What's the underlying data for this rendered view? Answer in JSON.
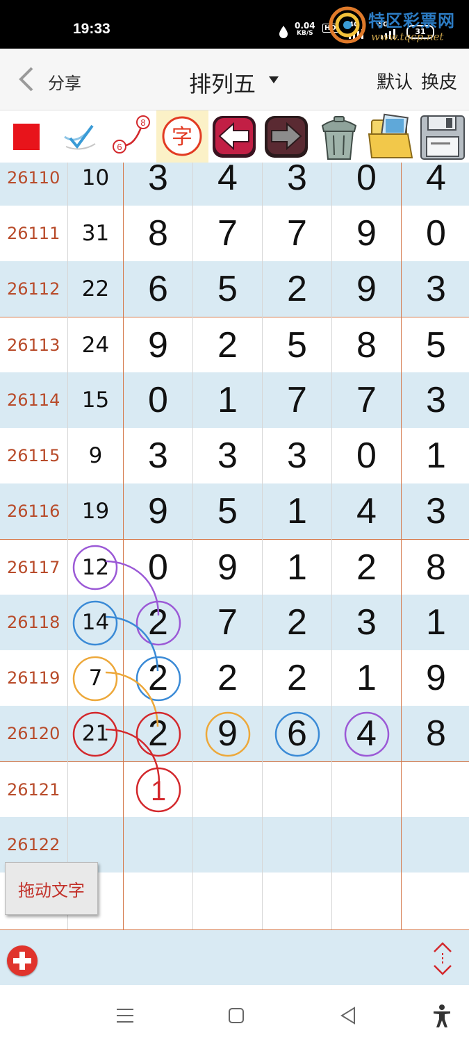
{
  "status_bar": {
    "time": "19:33",
    "net_speed": "0.04",
    "net_unit": "KB/S",
    "tag_hd": "HD",
    "tag_4g": "4G",
    "tag_5g": "5G",
    "battery": "31"
  },
  "watermark": {
    "name": "特区彩票网",
    "url": "www.tqcp.net"
  },
  "header": {
    "share_label": "分享",
    "title": "排列五",
    "default_label": "默认",
    "skin_label": "换皮"
  },
  "toolbar": {
    "items": [
      {
        "name": "red-square-icon",
        "color": "#e8141b"
      },
      {
        "name": "check-pen-icon"
      },
      {
        "name": "connect-line-icon",
        "label_a": "6",
        "label_b": "8"
      },
      {
        "name": "text-tool-icon",
        "label": "字"
      },
      {
        "name": "undo-arrow-icon"
      },
      {
        "name": "redo-arrow-icon"
      },
      {
        "name": "trash-bin-icon"
      },
      {
        "name": "image-folder-icon"
      },
      {
        "name": "floppy-save-icon"
      }
    ]
  },
  "table": {
    "rows": [
      {
        "period": "26110",
        "sum": "10",
        "digits": [
          "3",
          "4",
          "3",
          "0",
          "4"
        ]
      },
      {
        "period": "26111",
        "sum": "31",
        "digits": [
          "8",
          "7",
          "7",
          "9",
          "0"
        ]
      },
      {
        "period": "26112",
        "sum": "22",
        "digits": [
          "6",
          "5",
          "2",
          "9",
          "3"
        ]
      },
      {
        "period": "26113",
        "sum": "24",
        "digits": [
          "9",
          "2",
          "5",
          "8",
          "5"
        ]
      },
      {
        "period": "26114",
        "sum": "15",
        "digits": [
          "0",
          "1",
          "7",
          "7",
          "3"
        ]
      },
      {
        "period": "26115",
        "sum": "9",
        "digits": [
          "3",
          "3",
          "3",
          "0",
          "1"
        ]
      },
      {
        "period": "26116",
        "sum": "19",
        "digits": [
          "9",
          "5",
          "1",
          "4",
          "3"
        ]
      },
      {
        "period": "26117",
        "sum": "12",
        "digits": [
          "0",
          "9",
          "1",
          "2",
          "8"
        ]
      },
      {
        "period": "26118",
        "sum": "14",
        "digits": [
          "2",
          "7",
          "2",
          "3",
          "1"
        ]
      },
      {
        "period": "26119",
        "sum": "7",
        "digits": [
          "2",
          "2",
          "2",
          "1",
          "9"
        ]
      },
      {
        "period": "26120",
        "sum": "21",
        "digits": [
          "2",
          "9",
          "6",
          "4",
          "8"
        ]
      },
      {
        "period": "26121",
        "sum": "",
        "digits": [
          "",
          "",
          "",
          "",
          ""
        ]
      },
      {
        "period": "26122",
        "sum": "",
        "digits": [
          "",
          "",
          "",
          "",
          ""
        ]
      },
      {
        "period": "",
        "sum": "",
        "digits": [
          "",
          "",
          "",
          "",
          ""
        ]
      }
    ],
    "annotation_text": "1",
    "colors": {
      "purple": "#9b59d6",
      "blue": "#3a8ad6",
      "orange": "#eda83a",
      "red": "#d3282c",
      "period_text": "#b84b2a"
    }
  },
  "drag_button": {
    "label": "拖动文字"
  },
  "bottom_bar": {
    "add_icon": "plus-circle-icon",
    "resize_icon": "up-down-arrows-icon"
  },
  "nav_bar": {
    "menu_icon": "menu-icon",
    "home_icon": "square-home-icon",
    "back_icon": "triangle-back-icon",
    "accessibility_icon": "accessibility-icon"
  }
}
